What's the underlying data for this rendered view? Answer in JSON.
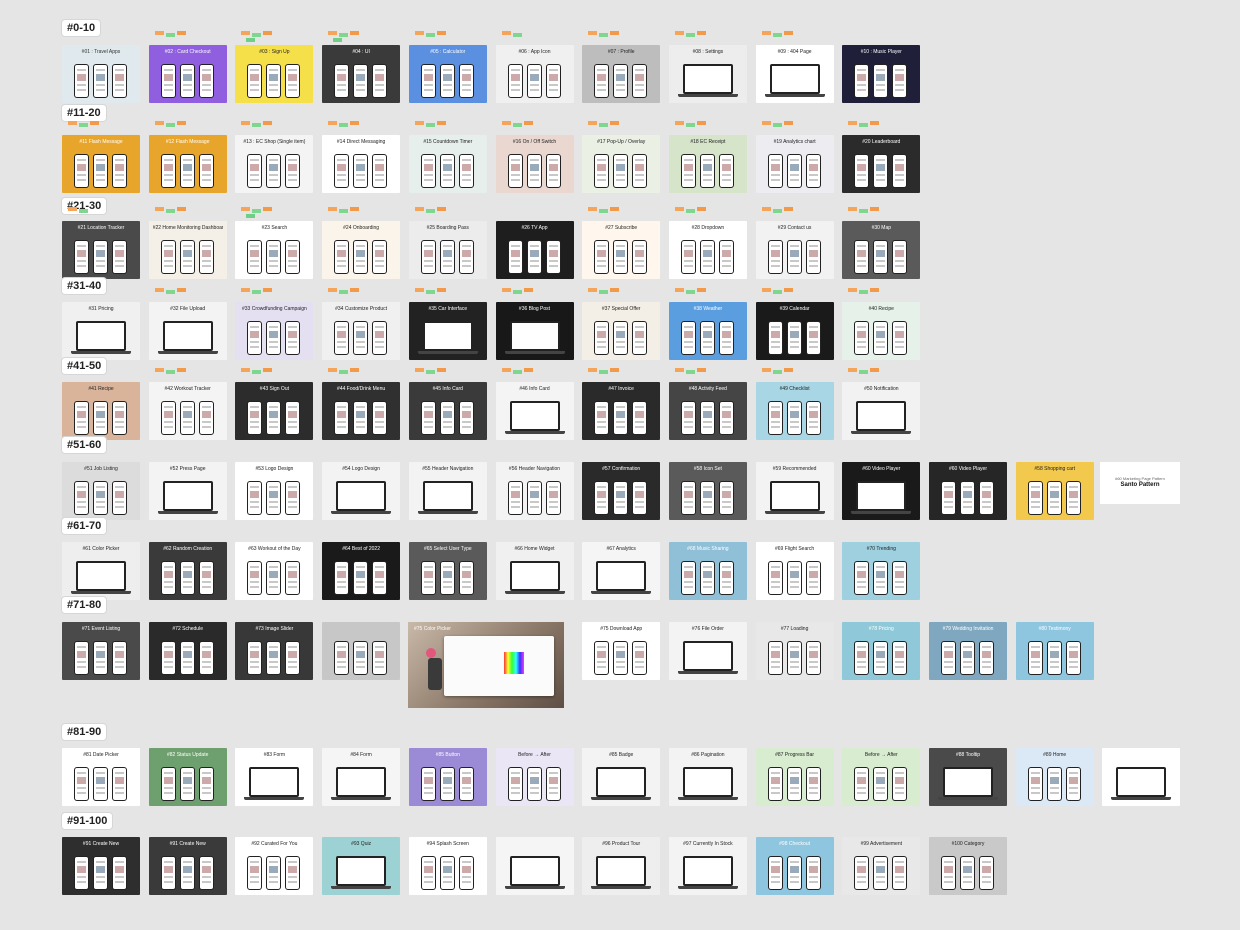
{
  "canvas": {
    "background": "#e5e5e5",
    "sticky_colors": [
      "#f5a55a",
      "#7ed68f",
      "#f29a4a",
      "#6fcf86"
    ],
    "rows": [
      {
        "label": "#0-10",
        "frames": [
          {
            "title": "#01 : Travel Apps",
            "bg": "#dfe9ee",
            "fg": "#333",
            "type": "phones",
            "notes": 0
          },
          {
            "title": "#02 : Card Checkout",
            "bg": "#8f5fe0",
            "fg": "#fff",
            "type": "phones",
            "notes": 3
          },
          {
            "title": "#03 : Sign Up",
            "bg": "#f5e04a",
            "fg": "#222",
            "type": "phones",
            "notes": 4
          },
          {
            "title": "#04 : UI",
            "bg": "#3a3a3a",
            "fg": "#fff",
            "type": "phones",
            "notes": 4
          },
          {
            "title": "#05 : Calculator",
            "bg": "#5b8fe0",
            "fg": "#fff",
            "type": "phones",
            "notes": 3
          },
          {
            "title": "#06 : App Icon",
            "bg": "#f0f0f0",
            "fg": "#222",
            "type": "phones",
            "notes": 2
          },
          {
            "title": "#07 : Profile",
            "bg": "#bdbdbd",
            "fg": "#222",
            "type": "phones",
            "notes": 3
          },
          {
            "title": "#08 : Settings",
            "bg": "#ededed",
            "fg": "#222",
            "type": "laptop",
            "notes": 3
          },
          {
            "title": "#09 : 404 Page",
            "bg": "#ffffff",
            "fg": "#222",
            "type": "laptop",
            "notes": 3
          },
          {
            "title": "#10 : Music Player",
            "bg": "#1f1f3a",
            "fg": "#fff",
            "type": "phones",
            "notes": 0
          }
        ]
      },
      {
        "label": "#11-20",
        "frames": [
          {
            "title": "#11 Flash Message",
            "bg": "#e7a52b",
            "fg": "#fff",
            "type": "phones",
            "notes": 3
          },
          {
            "title": "#12 Flash Message",
            "bg": "#e7a52b",
            "fg": "#fff",
            "type": "phones",
            "notes": 3
          },
          {
            "title": "#13 : EC Shop (Single item)",
            "bg": "#f4f4f4",
            "fg": "#222",
            "type": "phones",
            "notes": 3
          },
          {
            "title": "#14 Direct Messaging",
            "bg": "#ffffff",
            "fg": "#222",
            "type": "phones",
            "notes": 3
          },
          {
            "title": "#15 Countdown Timer",
            "bg": "#e6efec",
            "fg": "#222",
            "type": "phones",
            "notes": 3
          },
          {
            "title": "#16 On / Off Switch",
            "bg": "#ead8d0",
            "fg": "#222",
            "type": "phones",
            "notes": 3
          },
          {
            "title": "#17 Pop-Up / Overlay",
            "bg": "#eaf0e4",
            "fg": "#222",
            "type": "phones",
            "notes": 3
          },
          {
            "title": "#18 EC Receipt",
            "bg": "#d6e4c9",
            "fg": "#222",
            "type": "phones",
            "notes": 3
          },
          {
            "title": "#19 Analytics chart",
            "bg": "#ececf1",
            "fg": "#222",
            "type": "phones",
            "notes": 3
          },
          {
            "title": "#20 Leaderboard",
            "bg": "#2b2b2b",
            "fg": "#fff",
            "type": "phones",
            "notes": 3
          }
        ]
      },
      {
        "label": "#21-30",
        "frames": [
          {
            "title": "#21 Location Tracker",
            "bg": "#4a4a4a",
            "fg": "#fff",
            "type": "phones",
            "notes": 2
          },
          {
            "title": "#22 Home Monitoring Dashboard",
            "bg": "#f4efe7",
            "fg": "#222",
            "type": "phones",
            "notes": 3
          },
          {
            "title": "#23 Search",
            "bg": "#ffffff",
            "fg": "#222",
            "type": "phones",
            "notes": 4
          },
          {
            "title": "#24 Onboarding",
            "bg": "#fbf4ea",
            "fg": "#222",
            "type": "phones",
            "notes": 3
          },
          {
            "title": "#25 Boarding Pass",
            "bg": "#ececec",
            "fg": "#222",
            "type": "phones",
            "notes": 3
          },
          {
            "title": "#26 TV App",
            "bg": "#1e1e1e",
            "fg": "#fff",
            "type": "phones",
            "notes": 0
          },
          {
            "title": "#27 Subscribe",
            "bg": "#fff7ee",
            "fg": "#222",
            "type": "phones",
            "notes": 3
          },
          {
            "title": "#28 Dropdown",
            "bg": "#ffffff",
            "fg": "#222",
            "type": "phones",
            "notes": 3
          },
          {
            "title": "#29 Contact us",
            "bg": "#f2f2f2",
            "fg": "#222",
            "type": "phones",
            "notes": 3
          },
          {
            "title": "#30 Map",
            "bg": "#5a5a5a",
            "fg": "#fff",
            "type": "phones",
            "notes": 3
          }
        ]
      },
      {
        "label": "#31-40",
        "frames": [
          {
            "title": "#31 Pricing",
            "bg": "#f0f0f0",
            "fg": "#222",
            "type": "laptop",
            "notes": 0
          },
          {
            "title": "#32 File Upload",
            "bg": "#f3f3f3",
            "fg": "#222",
            "type": "laptop",
            "notes": 3
          },
          {
            "title": "#33 Crowdfunding Campaign",
            "bg": "#e4e0f2",
            "fg": "#222",
            "type": "phones",
            "notes": 3
          },
          {
            "title": "#34 Customize Product",
            "bg": "#f0f0f0",
            "fg": "#222",
            "type": "phones",
            "notes": 3
          },
          {
            "title": "#35 Car Interface",
            "bg": "#222222",
            "fg": "#fff",
            "type": "laptop",
            "notes": 3
          },
          {
            "title": "#36 Blog Post",
            "bg": "#181818",
            "fg": "#fff",
            "type": "laptop",
            "notes": 3
          },
          {
            "title": "#37 Special Offer",
            "bg": "#f3eee6",
            "fg": "#222",
            "type": "phones",
            "notes": 3
          },
          {
            "title": "#38 Weather",
            "bg": "#5b9ee0",
            "fg": "#fff",
            "type": "phones",
            "notes": 3
          },
          {
            "title": "#39 Calendar",
            "bg": "#1a1a1a",
            "fg": "#fff",
            "type": "phones",
            "notes": 3
          },
          {
            "title": "#40 Recipe",
            "bg": "#e6f1ea",
            "fg": "#222",
            "type": "phones",
            "notes": 3
          }
        ]
      },
      {
        "label": "#41-50",
        "frames": [
          {
            "title": "#41 Recipe",
            "bg": "#d9b49a",
            "fg": "#222",
            "type": "phones",
            "notes": 0
          },
          {
            "title": "#42 Workout Tracker",
            "bg": "#f4f4f4",
            "fg": "#222",
            "type": "phones",
            "notes": 3
          },
          {
            "title": "#43 Sign Out",
            "bg": "#2c2c2c",
            "fg": "#fff",
            "type": "phones",
            "notes": 3
          },
          {
            "title": "#44 Food/Drink Menu",
            "bg": "#303030",
            "fg": "#fff",
            "type": "phones",
            "notes": 3
          },
          {
            "title": "#45 Info Card",
            "bg": "#3a3a3a",
            "fg": "#fff",
            "type": "phones",
            "notes": 3
          },
          {
            "title": "#46 Info Card",
            "bg": "#f4f4f4",
            "fg": "#222",
            "type": "laptop",
            "notes": 3
          },
          {
            "title": "#47 Invoice",
            "bg": "#2a2a2a",
            "fg": "#fff",
            "type": "phones",
            "notes": 3
          },
          {
            "title": "#48 Activity Feed",
            "bg": "#454545",
            "fg": "#fff",
            "type": "phones",
            "notes": 3
          },
          {
            "title": "#49 Checklist",
            "bg": "#a8d6e4",
            "fg": "#222",
            "type": "phones",
            "notes": 3
          },
          {
            "title": "#50 Notification",
            "bg": "#f2f2f2",
            "fg": "#222",
            "type": "laptop",
            "notes": 3
          }
        ]
      },
      {
        "label": "#51-60",
        "frames": [
          {
            "title": "#51 Job Listing",
            "bg": "#dcdcdc",
            "fg": "#222",
            "type": "phones",
            "notes": 0
          },
          {
            "title": "#52 Press Page",
            "bg": "#f3f3f3",
            "fg": "#222",
            "type": "laptop",
            "notes": 0
          },
          {
            "title": "#53 Logo Design",
            "bg": "#ffffff",
            "fg": "#111",
            "type": "phones",
            "notes": 0
          },
          {
            "title": "#54 Logo Design",
            "bg": "#f3f3f3",
            "fg": "#222",
            "type": "laptop",
            "notes": 0
          },
          {
            "title": "#55 Header Navigation",
            "bg": "#f3f3f3",
            "fg": "#222",
            "type": "laptop",
            "notes": 0
          },
          {
            "title": "#56 Header Navigation",
            "bg": "#f3f3f3",
            "fg": "#222",
            "type": "phones",
            "notes": 0
          },
          {
            "title": "#57 Confirmation",
            "bg": "#2a2a2a",
            "fg": "#fff",
            "type": "phones",
            "notes": 0
          },
          {
            "title": "#58 Icon Set",
            "bg": "#5a5a5a",
            "fg": "#fff",
            "type": "phones",
            "notes": 0
          },
          {
            "title": "#59 Recommended",
            "bg": "#f3f3f3",
            "fg": "#222",
            "type": "laptop",
            "notes": 0
          },
          {
            "title": "#60 Video Player",
            "bg": "#1a1a1a",
            "fg": "#fff",
            "type": "laptop",
            "notes": 0
          },
          {
            "title": "#60 Video Player",
            "bg": "#262626",
            "fg": "#fff",
            "type": "phones",
            "notes": 0
          },
          {
            "title": "#58 Shopping cart",
            "bg": "#f2c94c",
            "fg": "#222",
            "type": "phones",
            "notes": 0
          }
        ]
      },
      {
        "label": "#61-70",
        "frames": [
          {
            "title": "#61 Color Picker",
            "bg": "#eeeeee",
            "fg": "#222",
            "type": "laptop",
            "notes": 0
          },
          {
            "title": "#62 Random Creation",
            "bg": "#3a3a3a",
            "fg": "#fff",
            "type": "phones",
            "notes": 0
          },
          {
            "title": "#63 Workout of the Day",
            "bg": "#ffffff",
            "fg": "#222",
            "type": "phones",
            "notes": 0
          },
          {
            "title": "#64 Best of 2022",
            "bg": "#1a1a1a",
            "fg": "#fff",
            "type": "phones",
            "notes": 0
          },
          {
            "title": "#65 Select User Type",
            "bg": "#5a5a5a",
            "fg": "#fff",
            "type": "phones",
            "notes": 0
          },
          {
            "title": "#66 Home Widget",
            "bg": "#f0f0f0",
            "fg": "#222",
            "type": "laptop",
            "notes": 0
          },
          {
            "title": "#67 Analytics",
            "bg": "#f5f5f5",
            "fg": "#222",
            "type": "laptop",
            "notes": 0
          },
          {
            "title": "#68 Music Sharing",
            "bg": "#8fc0d8",
            "fg": "#fff",
            "type": "phones",
            "notes": 0
          },
          {
            "title": "#69 Flight Search",
            "bg": "#ffffff",
            "fg": "#222",
            "type": "phones",
            "notes": 0
          },
          {
            "title": "#70 Trending",
            "bg": "#9ed0e0",
            "fg": "#222",
            "type": "phones",
            "notes": 0
          }
        ]
      },
      {
        "label": "#71-80",
        "frames": [
          {
            "title": "#71 Event Listing",
            "bg": "#4a4a4a",
            "fg": "#fff",
            "type": "phones",
            "notes": 0
          },
          {
            "title": "#72 Schedule",
            "bg": "#2a2a2a",
            "fg": "#fff",
            "type": "phones",
            "notes": 0
          },
          {
            "title": "#73 Image Slider",
            "bg": "#383838",
            "fg": "#fff",
            "type": "phones",
            "notes": 0
          },
          {
            "title": "",
            "bg": "#c7c7c7",
            "fg": "#222",
            "type": "phones",
            "notes": 0
          },
          {
            "title": "#75 Download App",
            "bg": "#ffffff",
            "fg": "#222",
            "type": "phones",
            "notes": 0
          },
          {
            "title": "#76 File Order",
            "bg": "#f3f3f3",
            "fg": "#222",
            "type": "laptop",
            "notes": 0
          },
          {
            "title": "#77 Loading",
            "bg": "#e8e8e8",
            "fg": "#222",
            "type": "phones",
            "notes": 0
          },
          {
            "title": "#78 Pricing",
            "bg": "#8fc8d8",
            "fg": "#fff",
            "type": "phones",
            "notes": 0
          },
          {
            "title": "#79 Wedding Invitation",
            "bg": "#7fa8c0",
            "fg": "#fff",
            "type": "phones",
            "notes": 0
          },
          {
            "title": "#80 Testimony",
            "bg": "#8ec6e0",
            "fg": "#fff",
            "type": "phones",
            "notes": 0
          }
        ]
      },
      {
        "label": "#81-90",
        "frames": [
          {
            "title": "#81 Date Picker",
            "bg": "#ffffff",
            "fg": "#222",
            "type": "phones",
            "notes": 0
          },
          {
            "title": "#82 Status Update",
            "bg": "#6e9f6e",
            "fg": "#fff",
            "type": "phones",
            "notes": 0
          },
          {
            "title": "#83 Form",
            "bg": "#ffffff",
            "fg": "#222",
            "type": "laptop",
            "notes": 0
          },
          {
            "title": "#84 Form",
            "bg": "#f5f5f5",
            "fg": "#222",
            "type": "laptop",
            "notes": 0
          },
          {
            "title": "#85 Button",
            "bg": "#9b8ad6",
            "fg": "#fff",
            "type": "phones",
            "notes": 0
          },
          {
            "title": "Before → After",
            "bg": "#ebe6f6",
            "fg": "#222",
            "type": "phones",
            "notes": 0
          },
          {
            "title": "#85 Badge",
            "bg": "#f3f3f3",
            "fg": "#222",
            "type": "laptop",
            "notes": 0
          },
          {
            "title": "#86 Pagination",
            "bg": "#f3f3f3",
            "fg": "#222",
            "type": "laptop",
            "notes": 0
          },
          {
            "title": "#87 Progress Bar",
            "bg": "#d8ecd0",
            "fg": "#222",
            "type": "phones",
            "notes": 0
          },
          {
            "title": "Before → After",
            "bg": "#d8ecd0",
            "fg": "#222",
            "type": "phones",
            "notes": 0
          },
          {
            "title": "#88 Tooltip",
            "bg": "#4a4a4a",
            "fg": "#fff",
            "type": "laptop",
            "notes": 0
          },
          {
            "title": "#89 Home",
            "bg": "#dbe8f5",
            "fg": "#222",
            "type": "phones",
            "notes": 0
          },
          {
            "title": "",
            "bg": "#ffffff",
            "fg": "#222",
            "type": "laptop",
            "notes": 0
          }
        ]
      },
      {
        "label": "#91-100",
        "frames": [
          {
            "title": "#91 Create New",
            "bg": "#2e2e2e",
            "fg": "#fff",
            "type": "phones",
            "notes": 0
          },
          {
            "title": "#91 Create New",
            "bg": "#3a3a3a",
            "fg": "#fff",
            "type": "phones",
            "notes": 0
          },
          {
            "title": "#92 Curated For You",
            "bg": "#ffffff",
            "fg": "#222",
            "type": "phones",
            "notes": 0
          },
          {
            "title": "#93 Quiz",
            "bg": "#9cd2d4",
            "fg": "#222",
            "type": "laptop",
            "notes": 0
          },
          {
            "title": "#94 Splash Screen",
            "bg": "#ffffff",
            "fg": "#222",
            "type": "phones",
            "notes": 0
          },
          {
            "title": "",
            "bg": "#f5f5f5",
            "fg": "#222",
            "type": "laptop",
            "notes": 0
          },
          {
            "title": "#96 Product Tour",
            "bg": "#eeeeee",
            "fg": "#222",
            "type": "laptop",
            "notes": 0
          },
          {
            "title": "#97 Currently In Stock",
            "bg": "#f3f3f3",
            "fg": "#222",
            "type": "laptop",
            "notes": 0
          },
          {
            "title": "#98 Checkout",
            "bg": "#8ec6e0",
            "fg": "#fff",
            "type": "phones",
            "notes": 0
          },
          {
            "title": "#99 Advertisement",
            "bg": "#e8e8e8",
            "fg": "#222",
            "type": "phones",
            "notes": 0
          },
          {
            "title": "#100 Category",
            "bg": "#c9c9c9",
            "fg": "#222",
            "type": "phones",
            "notes": 0
          }
        ]
      }
    ],
    "big_frame": {
      "title": "#75 Color Picker"
    },
    "lonely_frame": {
      "line1": "#60 Marketing Page Pattern",
      "line2": "Santo Pattern"
    }
  }
}
